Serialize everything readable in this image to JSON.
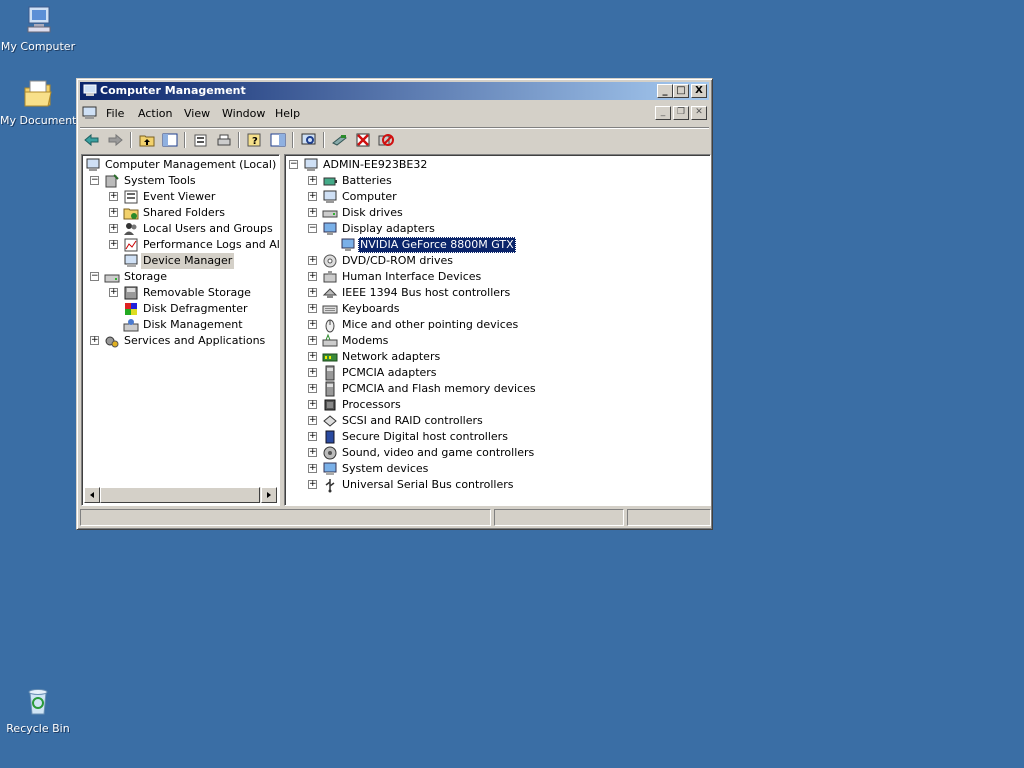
{
  "desktop": {
    "icons": [
      {
        "label": "My Computer"
      },
      {
        "label": "My Documents"
      },
      {
        "label": "Recycle Bin"
      }
    ]
  },
  "window": {
    "title": "Computer Management",
    "menu": [
      "File",
      "Action",
      "View",
      "Window",
      "Help"
    ],
    "caption_buttons": {
      "minimize": "_",
      "maximize": "□",
      "close": "X"
    },
    "toolbar_icons": [
      "back-icon",
      "forward-icon",
      "up-folder-icon",
      "show-hide-tree-icon",
      "properties-icon",
      "print-icon",
      "help-icon",
      "show-action-pane-icon",
      "scan-hardware-icon",
      "update-driver-icon",
      "uninstall-icon",
      "disable-icon"
    ]
  },
  "left_tree": {
    "root": "Computer Management (Local)",
    "items": [
      {
        "label": "System Tools",
        "level": 1,
        "expander": "−"
      },
      {
        "label": "Event Viewer",
        "level": 2,
        "expander": "+"
      },
      {
        "label": "Shared Folders",
        "level": 2,
        "expander": "+"
      },
      {
        "label": "Local Users and Groups",
        "level": 2,
        "expander": "+"
      },
      {
        "label": "Performance Logs and Alerts",
        "level": 2,
        "expander": "+"
      },
      {
        "label": "Device Manager",
        "level": 2,
        "expander": "",
        "selected": true
      },
      {
        "label": "Storage",
        "level": 1,
        "expander": "−"
      },
      {
        "label": "Removable Storage",
        "level": 2,
        "expander": "+"
      },
      {
        "label": "Disk Defragmenter",
        "level": 2,
        "expander": ""
      },
      {
        "label": "Disk Management",
        "level": 2,
        "expander": ""
      },
      {
        "label": "Services and Applications",
        "level": 1,
        "expander": "+"
      }
    ]
  },
  "device_tree": {
    "root": "ADMIN-EE923BE32",
    "categories": [
      {
        "label": "Batteries",
        "expander": "+"
      },
      {
        "label": "Computer",
        "expander": "+"
      },
      {
        "label": "Disk drives",
        "expander": "+"
      },
      {
        "label": "Display adapters",
        "expander": "−"
      },
      {
        "label": "NVIDIA GeForce 8800M GTX",
        "expander": "",
        "child": true,
        "selected": true
      },
      {
        "label": "DVD/CD-ROM drives",
        "expander": "+"
      },
      {
        "label": "Human Interface Devices",
        "expander": "+"
      },
      {
        "label": "IEEE 1394 Bus host controllers",
        "expander": "+"
      },
      {
        "label": "Keyboards",
        "expander": "+"
      },
      {
        "label": "Mice and other pointing devices",
        "expander": "+"
      },
      {
        "label": "Modems",
        "expander": "+"
      },
      {
        "label": "Network adapters",
        "expander": "+"
      },
      {
        "label": "PCMCIA adapters",
        "expander": "+"
      },
      {
        "label": "PCMCIA and Flash memory devices",
        "expander": "+"
      },
      {
        "label": "Processors",
        "expander": "+"
      },
      {
        "label": "SCSI and RAID controllers",
        "expander": "+"
      },
      {
        "label": "Secure Digital host controllers",
        "expander": "+"
      },
      {
        "label": "Sound, video and game controllers",
        "expander": "+"
      },
      {
        "label": "System devices",
        "expander": "+"
      },
      {
        "label": "Universal Serial Bus controllers",
        "expander": "+"
      }
    ]
  },
  "statusbar": {
    "cells": [
      "",
      "",
      ""
    ]
  },
  "colors": {
    "desktop": "#3a6ea5",
    "title_start": "#0a246a",
    "title_end": "#a6caf0",
    "selection": "#0a246a",
    "face": "#d4d0c8"
  }
}
